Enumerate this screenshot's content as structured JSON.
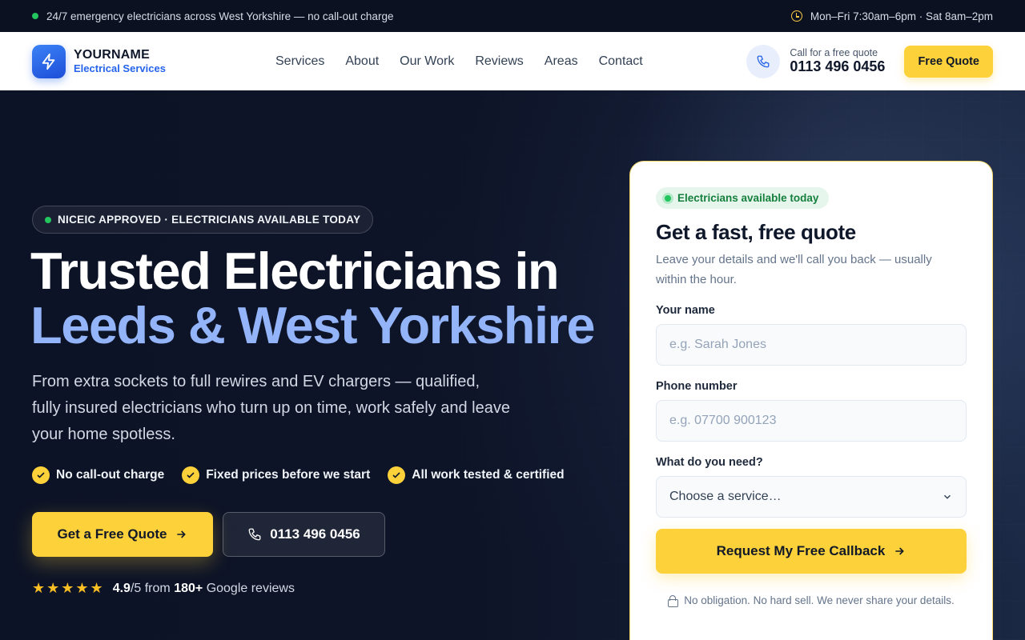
{
  "topbar": {
    "announcement": "24/7 emergency electricians across West Yorkshire — no call-out charge",
    "hours": "Mon–Fri 7:30am–6pm · Sat 8am–2pm"
  },
  "header": {
    "brand_name": "YOURNAME",
    "brand_sub": "Electrical Services",
    "nav": [
      "Services",
      "About",
      "Our Work",
      "Reviews",
      "Areas",
      "Contact"
    ],
    "call_label": "Call for a free quote",
    "phone": "0113 496 0456",
    "quote_button": "Free Quote"
  },
  "hero": {
    "badge": "NICEIC APPROVED · ELECTRICIANS AVAILABLE TODAY",
    "title_line1": "Trusted Electricians in",
    "title_line2": "Leeds & West Yorkshire",
    "lead": "From extra sockets to full rewires and EV chargers — qualified, fully insured electricians who turn up on time, work safely and leave your home spotless.",
    "checks": [
      "No call-out charge",
      "Fixed prices before we start",
      "All work tested & certified"
    ],
    "cta_primary": "Get a Free Quote",
    "cta_phone": "0113 496 0456",
    "rating_score": "4.9",
    "rating_out_of": "/5 from",
    "rating_count": "180+",
    "rating_source": "Google reviews",
    "stars": 5
  },
  "form": {
    "availability": "Electricians available today",
    "title": "Get a fast, free quote",
    "description": "Leave your details and we'll call you back — usually within the hour.",
    "name_label": "Your name",
    "name_placeholder": "e.g. Sarah Jones",
    "phone_label": "Phone number",
    "phone_placeholder": "e.g. 07700 900123",
    "service_label": "What do you need?",
    "service_value": "Choose a service…",
    "submit": "Request My Free Callback",
    "note": "No obligation. No hard sell. We never share your details."
  },
  "colors": {
    "accent_yellow": "#fdd13a",
    "brand_blue": "#2563eb",
    "hero_highlight": "#93b4f8",
    "dark_bg": "#0f1629"
  }
}
